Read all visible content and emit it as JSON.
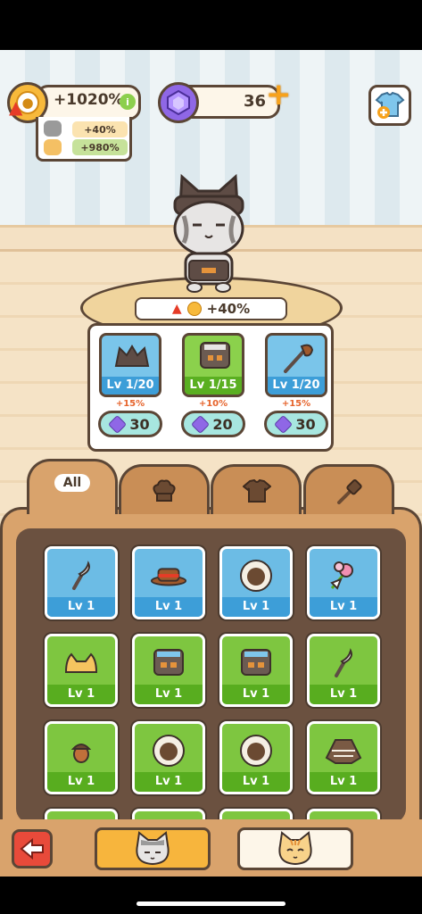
{
  "hud": {
    "paw_bonus": "+1020%",
    "info_icon": "i",
    "bonus_gray_cat": "+40%",
    "bonus_orange_cat": "+980%",
    "gems": "36",
    "plus_icon": "+"
  },
  "equipped": {
    "bonus_label": "+40%",
    "slots": [
      {
        "type": "hat",
        "level": "Lv 1/20",
        "pct": "+15%",
        "cost": "30",
        "color": "blue"
      },
      {
        "type": "shirt",
        "level": "Lv 1/15",
        "pct": "+10%",
        "cost": "20",
        "color": "green"
      },
      {
        "type": "tool",
        "level": "Lv 1/20",
        "pct": "+15%",
        "cost": "30",
        "color": "blue"
      }
    ]
  },
  "tabs": {
    "all": "All",
    "hat_icon": "chef-hat-icon",
    "shirt_icon": "shirt-icon",
    "tool_icon": "spatula-icon"
  },
  "items": [
    {
      "level": "Lv 1",
      "color": "blue",
      "icon": "sickle-icon"
    },
    {
      "level": "Lv 1",
      "color": "blue",
      "icon": "straw-hat-icon"
    },
    {
      "level": "Lv 1",
      "color": "blue",
      "icon": "fluffy-collar-icon"
    },
    {
      "level": "Lv 1",
      "color": "blue",
      "icon": "flower-bouquet-icon"
    },
    {
      "level": "Lv 1",
      "color": "green",
      "icon": "cat-ear-hat-icon"
    },
    {
      "level": "Lv 1",
      "color": "green",
      "icon": "apron-icon"
    },
    {
      "level": "Lv 1",
      "color": "green",
      "icon": "apron-icon"
    },
    {
      "level": "Lv 1",
      "color": "green",
      "icon": "sickle-icon"
    },
    {
      "level": "Lv 1",
      "color": "green",
      "icon": "acorn-icon"
    },
    {
      "level": "Lv 1",
      "color": "green",
      "icon": "fluffy-collar-icon"
    },
    {
      "level": "Lv 1",
      "color": "green",
      "icon": "fluffy-collar-icon"
    },
    {
      "level": "Lv 1",
      "color": "green",
      "icon": "poncho-icon"
    }
  ],
  "colors": {
    "outline": "#5b4636",
    "blue": "#6cbce5",
    "green": "#7ec640",
    "gold": "#f7b93b",
    "gem": "#8f67e6",
    "red": "#e84a3a"
  }
}
